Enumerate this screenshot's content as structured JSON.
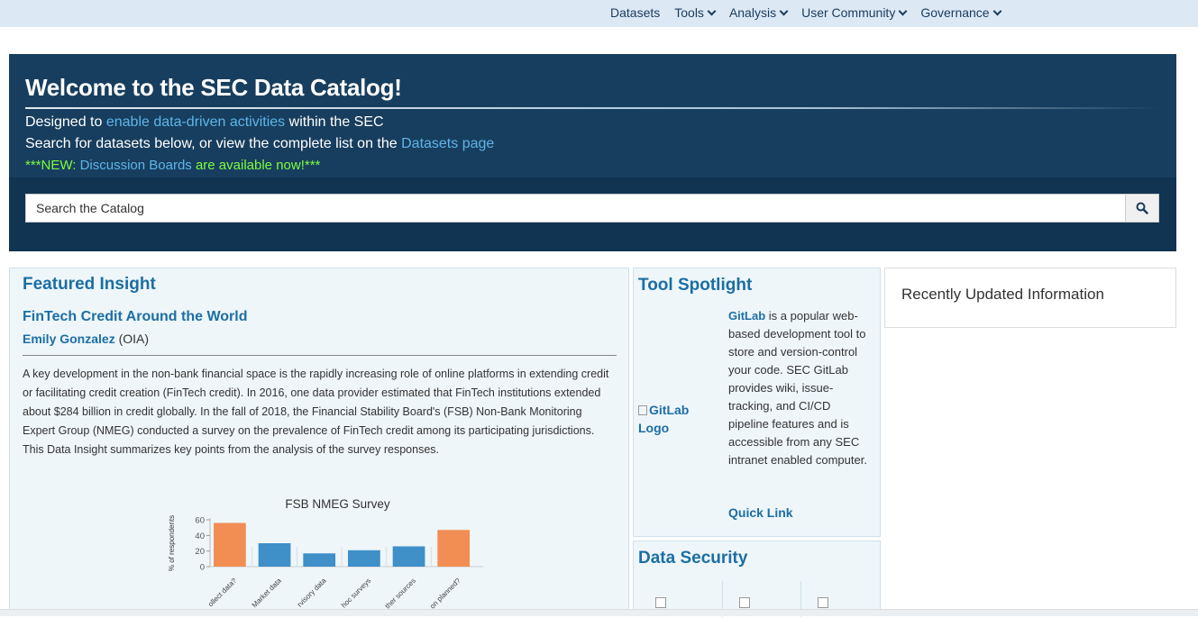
{
  "nav": {
    "items": [
      {
        "label": "Datasets",
        "dropdown": false
      },
      {
        "label": "Tools",
        "dropdown": true
      },
      {
        "label": "Analysis",
        "dropdown": true
      },
      {
        "label": "User Community",
        "dropdown": true
      },
      {
        "label": "Governance",
        "dropdown": true
      }
    ]
  },
  "hero": {
    "title": "Welcome to the SEC Data Catalog!",
    "line1_pre": "Designed to ",
    "line1_link": "enable data-driven activities",
    "line1_post": " within the SEC",
    "line2_pre": "Search for datasets below, or view the complete list on the ",
    "line2_link": "Datasets page",
    "line3_pre": "***NEW: ",
    "line3_link": "Discussion Boards",
    "line3_post": " are available now!***"
  },
  "search": {
    "placeholder": "Search the Catalog",
    "icon": "search-icon"
  },
  "featured": {
    "heading": "Featured Insight",
    "article_title": "FinTech Credit Around the World",
    "author_name": "Emily Gonzalez",
    "author_org": " (OIA)",
    "body": "A key development in the non-bank financial space is the rapidly increasing role of online platforms in extending credit or facilitating credit creation (FinTech credit). In 2016, one data provider estimated that FinTech institutions extended about $284 billion in credit globally. In the fall of 2018, the Financial Stability Board's (FSB) Non-Bank Monitoring Expert Group (NMEG) conducted a survey on the prevalence of FinTech credit among its participating jurisdictions. This Data Insight summarizes key points from the analysis of the survey responses."
  },
  "chart_data": {
    "type": "bar",
    "title": "FSB NMEG Survey",
    "ylabel": "% of respondents",
    "ylim": [
      0,
      60
    ],
    "yticks": [
      0,
      20,
      40,
      60
    ],
    "categories": [
      "Collect data?",
      "Market data",
      "Supervisory data",
      "Ad hoc surveys",
      "Other sources",
      "Collection planned?"
    ],
    "tick_labels_visible": [
      "ollect data?",
      "Market data",
      "rvisory data",
      "hoc surveys",
      "ther sources",
      "on planned?"
    ],
    "values": [
      56,
      30,
      17,
      21,
      26,
      47
    ],
    "colors": [
      "#f28e54",
      "#3f8fc8",
      "#3f8fc8",
      "#3f8fc8",
      "#3f8fc8",
      "#f28e54"
    ]
  },
  "tool": {
    "heading": "Tool Spotlight",
    "logo_alt": "GitLab Logo",
    "name": "GitLab",
    "desc": " is a popular web-based development tool to store and version-control your code. SEC GitLab provides wiki, issue-tracking, and CI/CD pipeline features and is accessible from any SEC intranet enabled computer.",
    "quick_link": "Quick Link"
  },
  "security": {
    "heading": "Data Security"
  },
  "recent": {
    "heading": "Recently Updated Information"
  }
}
